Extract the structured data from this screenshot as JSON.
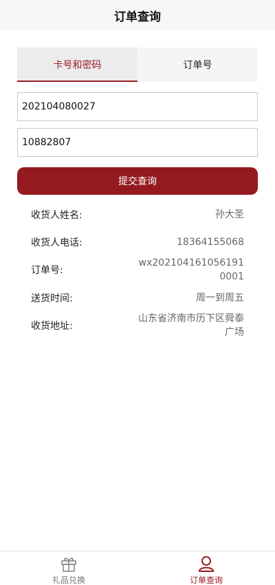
{
  "header": {
    "title": "订单查询"
  },
  "tabs": [
    {
      "label": "卡号和密码",
      "active": true
    },
    {
      "label": "订单号",
      "active": false
    }
  ],
  "form": {
    "card_number": "202104080027",
    "password": "10882807",
    "submit_label": "提交查询"
  },
  "order_info": [
    {
      "label": "收货人姓名:",
      "value": "孙大圣"
    },
    {
      "label": "收货人电话:",
      "value": "18364155068"
    },
    {
      "label": "订单号:",
      "value": "wx202104161056191 0001"
    },
    {
      "label": "送货时间:",
      "value": "周一到周五"
    },
    {
      "label": "收货地址:",
      "value": "山东省济南市历下区舜泰广场"
    }
  ],
  "tabbar": [
    {
      "label": "礼品兑换",
      "icon": "gift-icon",
      "active": false
    },
    {
      "label": "订单查询",
      "icon": "user-icon",
      "active": true
    }
  ],
  "colors": {
    "accent": "#951a20",
    "header_bg": "#f7f7f7"
  }
}
